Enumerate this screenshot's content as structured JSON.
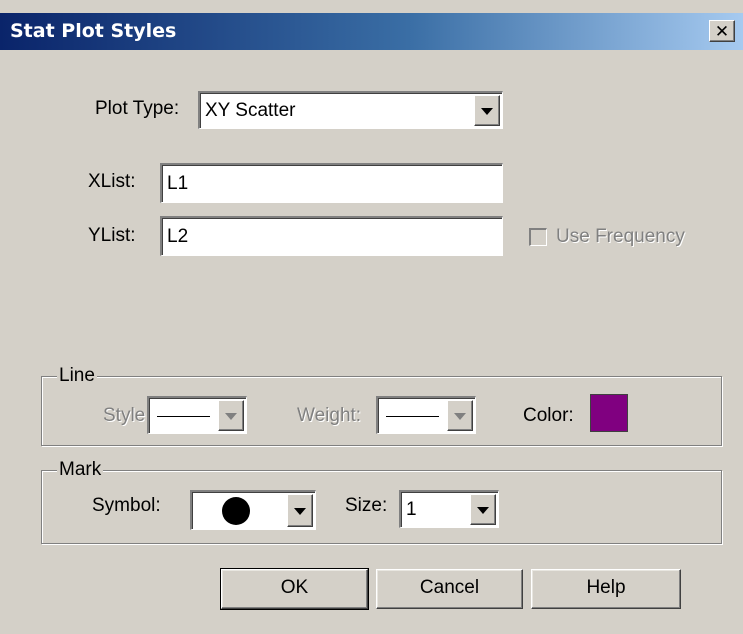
{
  "window": {
    "title": "Stat Plot Styles",
    "close_glyph": "✕"
  },
  "plot_type": {
    "label": "Plot Type:",
    "value": "XY Scatter"
  },
  "xlist": {
    "label": "XList:",
    "value": "L1"
  },
  "ylist": {
    "label": "YList:",
    "value": "L2"
  },
  "use_frequency": {
    "label": "Use Frequency",
    "checked": false,
    "enabled": false
  },
  "line_group": {
    "legend": "Line",
    "style_label": "Style:",
    "weight_label": "Weight:",
    "color_label": "Color:",
    "color_value": "#800080"
  },
  "mark_group": {
    "legend": "Mark",
    "symbol_label": "Symbol:",
    "symbol_icon": "filled-circle-icon",
    "size_label": "Size:",
    "size_value": "1"
  },
  "buttons": {
    "ok": "OK",
    "cancel": "Cancel",
    "help": "Help"
  }
}
